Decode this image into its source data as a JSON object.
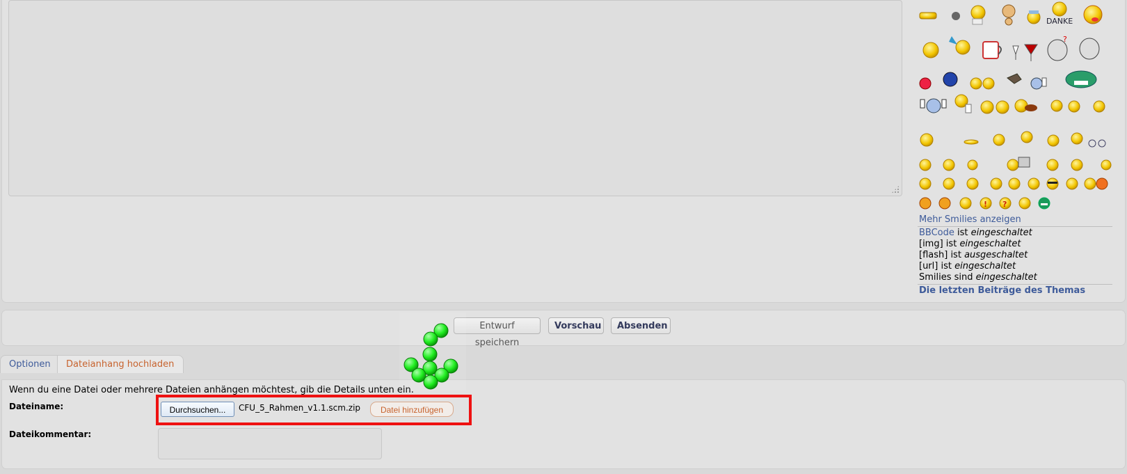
{
  "editor": {
    "smilies_more_label": "Mehr Smilies anzeigen",
    "bbcode": {
      "bbcode_link": "BBCode",
      "bbcode_ist": "ist",
      "bbcode_state": "eingeschaltet",
      "img_prefix": "[img] ist",
      "img_state": "eingeschaltet",
      "flash_prefix": "[flash] ist",
      "flash_state": "ausgeschaltet",
      "url_prefix": "[url] ist",
      "url_state": "eingeschaltet",
      "smilies_prefix": "Smilies sind",
      "smilies_state": "eingeschaltet"
    },
    "recent_posts_label": "Die letzten Beiträge des Themas",
    "smilies_icons": [
      "smiley-icon",
      "tongue-icon",
      "danke-icon",
      "wine-glass-icon",
      "coffee-cup-icon",
      "mouse-icon",
      "thumbs-up-icon",
      "computer-icon",
      "question-icon",
      "exclamation-icon",
      "devil-icon",
      "sunglasses-icon"
    ]
  },
  "actions": {
    "draft_label": "Entwurf speichern",
    "preview_label": "Vorschau",
    "submit_label": "Absenden"
  },
  "tabs": {
    "options_label": "Optionen",
    "upload_label": "Dateianhang hochladen"
  },
  "attachment": {
    "intro_text": "Wenn du eine Datei oder mehrere Dateien anhängen möchtest, gib die Details unten ein.",
    "filename_label": "Dateiname:",
    "browse_label": "Durchsuchen...",
    "selected_file": "CFU_5_Rahmen_v1.1.scm.zip",
    "add_file_label": "Datei hinzufügen",
    "comment_label": "Dateikommentar:",
    "comment_value": ""
  },
  "colors": {
    "link": "#3e5b9a",
    "accent_orange": "#c7632e",
    "highlight_red": "#ee1111",
    "spinner_green": "#22ee22"
  }
}
